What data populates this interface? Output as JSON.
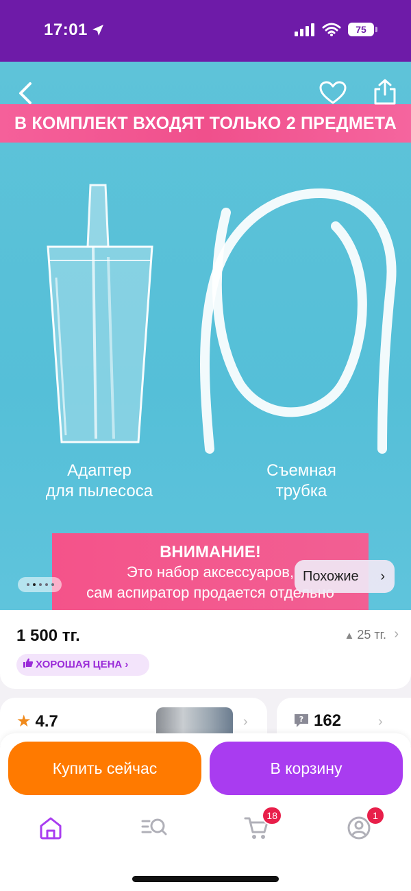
{
  "status_bar": {
    "time": "17:01",
    "battery": "75"
  },
  "hero": {
    "banner": "В КОМПЛЕКТ ВХОДЯТ ТОЛЬКО 2 ПРЕДМЕТА",
    "item1": [
      "Адаптер",
      "для пылесоса"
    ],
    "item2": [
      "Съемная",
      "трубка"
    ],
    "warning_title": "ВНИМАНИЕ!",
    "warning_lines": [
      "Это набор аксессуаров,",
      "сам аспиратор продается отдельно"
    ],
    "similar_label": "Похожие",
    "image_count": 5,
    "image_index": 2
  },
  "price": {
    "current": "1 500 тг.",
    "change": "25 тг.",
    "good_price": "ХОРОШАЯ ЦЕНА"
  },
  "rating": {
    "value": "4.7"
  },
  "questions": {
    "count": "162"
  },
  "actions": {
    "buy_now": "Купить сейчас",
    "add_to_cart": "В корзину"
  },
  "nav": {
    "cart_badge": "18",
    "profile_badge": "1"
  },
  "colors": {
    "brand": "#6e1ba8",
    "accent_purple": "#a93cf0",
    "accent_orange": "#ff7a00",
    "banner_pink": "#f0508c"
  },
  "icons": [
    "location-arrow-icon",
    "signal-icon",
    "wifi-icon",
    "back-icon",
    "heart-icon",
    "share-icon",
    "star-icon",
    "thumbs-up-icon",
    "question-icon",
    "home-icon",
    "catalog-search-icon",
    "cart-icon",
    "profile-icon"
  ]
}
